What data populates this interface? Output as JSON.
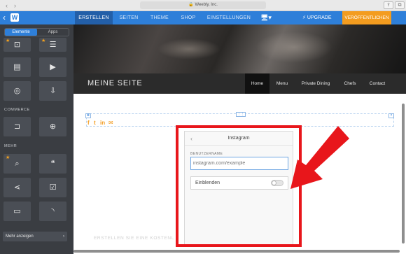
{
  "browser": {
    "url": "Weebly, Inc."
  },
  "topbar": {
    "tabs": [
      {
        "label": "ERSTELLEN"
      },
      {
        "label": "SEITEN"
      },
      {
        "label": "THEME"
      },
      {
        "label": "SHOP"
      },
      {
        "label": "EINSTELLUNGEN"
      }
    ],
    "upgrade_label": "UPGRADE",
    "publish_label": "VERÖFFENTLICHEN",
    "accent_color": "#2e7fd9",
    "publish_color": "#f39c1f"
  },
  "sidebar": {
    "segment": {
      "elements_label": "Elemente",
      "apps_label": "Apps"
    },
    "commerce_label": "COMMERCE",
    "more_label": "MEHR",
    "show_more_label": "Mehr anzeigen",
    "tiles": [
      {
        "icon": "contact-form-icon"
      },
      {
        "icon": "form-builder-icon"
      },
      {
        "icon": "document-icon"
      },
      {
        "icon": "video-icon"
      },
      {
        "icon": "compass-icon"
      },
      {
        "icon": "file-download-icon"
      },
      {
        "icon": "product-tag-icon"
      },
      {
        "icon": "product-search-icon"
      },
      {
        "icon": "search-icon"
      },
      {
        "icon": "code-quote-icon"
      },
      {
        "icon": "social-share-icon"
      },
      {
        "icon": "checklist-icon"
      },
      {
        "icon": "chat-bubble-icon"
      },
      {
        "icon": "rss-icon"
      }
    ]
  },
  "site": {
    "title": "MEINE SEITE",
    "nav": [
      {
        "label": "Home"
      },
      {
        "label": "Menu"
      },
      {
        "label": "Private Dining"
      },
      {
        "label": "Chefs"
      },
      {
        "label": "Contact"
      }
    ],
    "footer_text": "ERSTELLEN SIE EINE KOSTENL"
  },
  "modal": {
    "title": "Instagram",
    "field_label": "BENUTZERNAME",
    "input_value": "",
    "input_placeholder": "instagram.com/example",
    "toggle_label": "Einblenden",
    "toggle_on": false
  },
  "highlight": {
    "color": "#e8161b"
  }
}
